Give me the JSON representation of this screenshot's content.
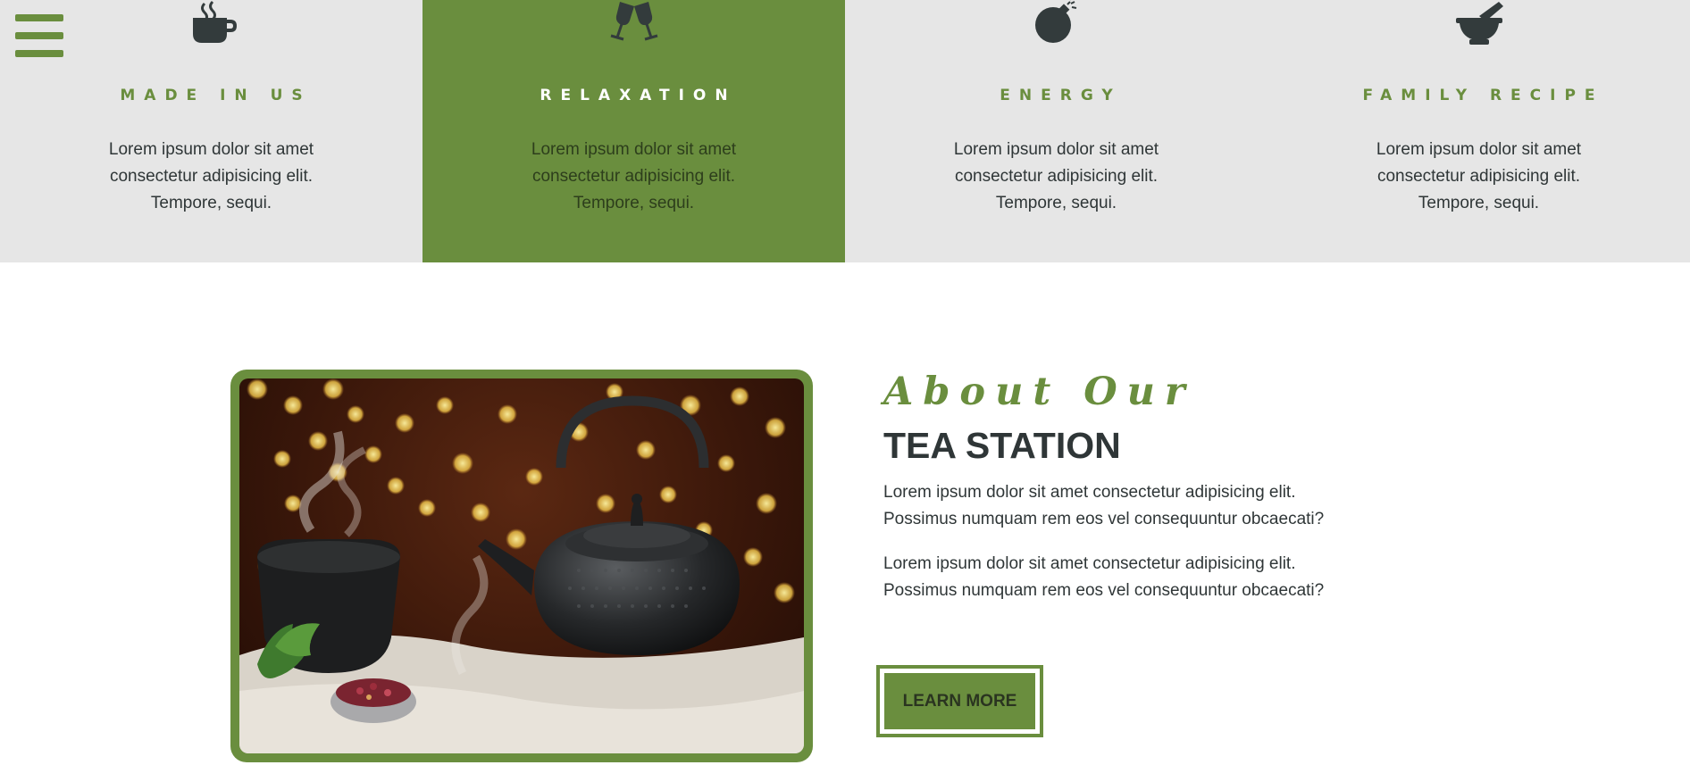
{
  "nav": {
    "menu_icon": "hamburger-menu-icon"
  },
  "features": [
    {
      "icon": "coffee-cup-icon",
      "title": "MADE IN US",
      "text": "Lorem ipsum dolor sit amet consectetur adipisicing elit. Tempore, sequi.",
      "active": false
    },
    {
      "icon": "glass-cheers-icon",
      "title": "RELAXATION",
      "text": "Lorem ipsum dolor sit amet consectetur adipisicing elit. Tempore, sequi.",
      "active": true
    },
    {
      "icon": "bomb-icon",
      "title": "ENERGY",
      "text": "Lorem ipsum dolor sit amet consectetur adipisicing elit. Tempore, sequi.",
      "active": false
    },
    {
      "icon": "mortar-pestle-icon",
      "title": "FAMILY RECIPE",
      "text": "Lorem ipsum dolor sit amet consectetur adipisicing elit. Tempore, sequi.",
      "active": false
    }
  ],
  "about": {
    "script_heading": "About Our",
    "title": "TEA STATION",
    "paragraphs": [
      "Lorem ipsum dolor sit amet consectetur adipisicing elit. Possimus numquam rem eos vel consequuntur obcaecati?",
      "Lorem ipsum dolor sit amet consectetur adipisicing elit. Possimus numquam rem eos vel consequuntur obcaecati?"
    ],
    "button_label": "LEARN MORE",
    "image": "tea-kettle-photo"
  },
  "colors": {
    "accent": "#6a8e3e",
    "band": "#e6e6e6",
    "text": "#2f3637"
  }
}
